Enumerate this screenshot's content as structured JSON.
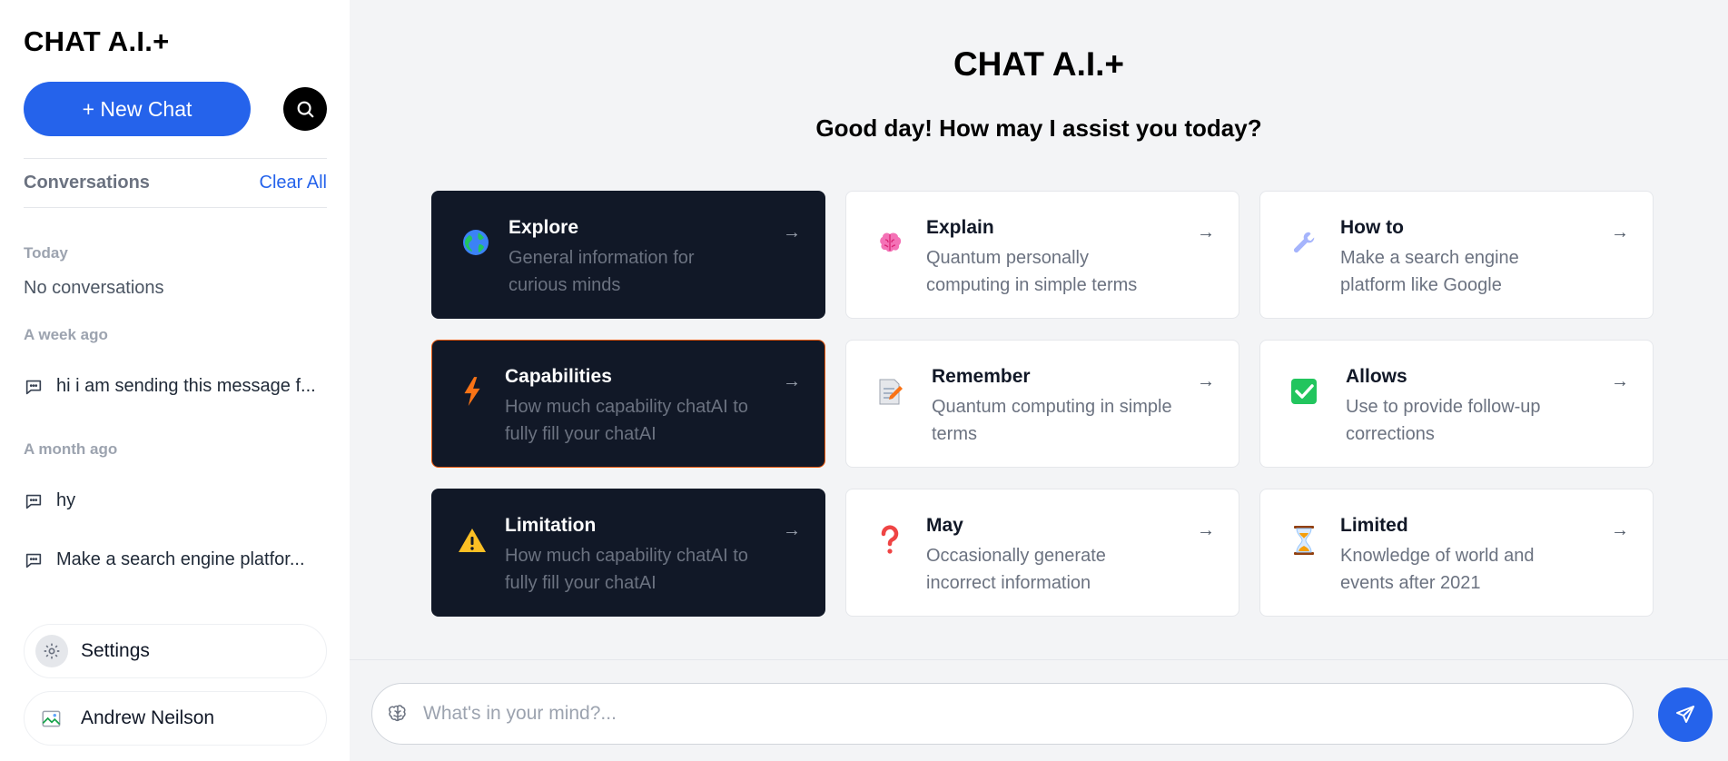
{
  "sidebar": {
    "brand": "CHAT A.I.+",
    "new_chat_label": "+ New Chat",
    "conversations_title": "Conversations",
    "clear_all_label": "Clear All",
    "groups": {
      "today_label": "Today",
      "today_empty": "No conversations",
      "week_label": "A week ago",
      "month_label": "A month ago"
    },
    "week_items": [
      "hi i am sending this message f..."
    ],
    "month_items": [
      "hy",
      "Make a search engine platfor..."
    ],
    "settings_label": "Settings",
    "user_name": "Andrew Neilson"
  },
  "main": {
    "title": "CHAT A.I.+",
    "greeting": "Good day! How may I assist you today?",
    "arrow": "→",
    "cards": [
      {
        "icon": "globe-icon",
        "title": "Explore",
        "description": "General information for curious minds",
        "theme": "dark"
      },
      {
        "icon": "brain-icon",
        "title": "Explain",
        "description": "Quantum personally computing in simple terms",
        "theme": "light"
      },
      {
        "icon": "wrench-icon",
        "title": "How to",
        "description": "Make a search engine platform like Google",
        "theme": "light"
      },
      {
        "icon": "lightning-icon",
        "title": "Capabilities",
        "description": "How much capability chatAI to fully fill your chatAI",
        "theme": "dark",
        "accent": "#ea580c"
      },
      {
        "icon": "memo-icon",
        "title": "Remember",
        "description": "Quantum computing in simple terms",
        "theme": "light"
      },
      {
        "icon": "checkmark-icon",
        "title": "Allows",
        "description": "Use to provide follow-up corrections",
        "theme": "light"
      },
      {
        "icon": "warning-icon",
        "title": "Limitation",
        "description": "How much capability chatAI to fully fill your chatAI",
        "theme": "dark"
      },
      {
        "icon": "question-icon",
        "title": "May",
        "description": "Occasionally generate incorrect information",
        "theme": "light"
      },
      {
        "icon": "hourglass-icon",
        "title": "Limited",
        "description": "Knowledge of world and events after 2021",
        "theme": "light"
      }
    ]
  },
  "composer": {
    "placeholder": "What's in your mind?...",
    "value": ""
  },
  "colors": {
    "primary": "#2563eb",
    "dark_card": "#111827",
    "accent_border": "#ea580c",
    "background": "#f3f4f6"
  }
}
